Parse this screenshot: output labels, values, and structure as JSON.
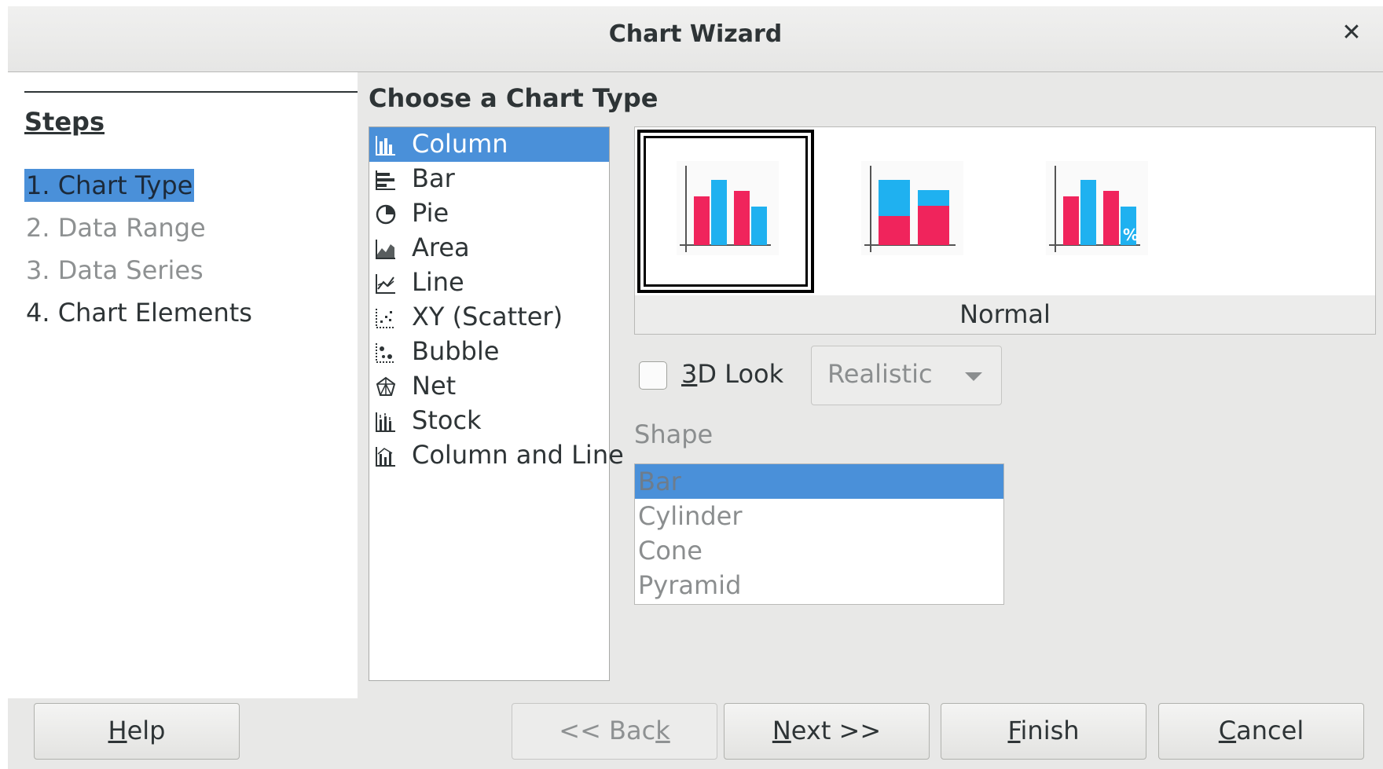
{
  "window": {
    "title": "Chart Wizard",
    "close_glyph": "✕"
  },
  "steps": {
    "heading": "Steps",
    "items": [
      {
        "label": "1. Chart Type",
        "state": "active"
      },
      {
        "label": "2. Data Range",
        "state": "disabled"
      },
      {
        "label": "3. Data Series",
        "state": "disabled"
      },
      {
        "label": "4. Chart Elements",
        "state": "normal"
      }
    ]
  },
  "main": {
    "section_title": "Choose a Chart Type",
    "chart_types": [
      {
        "label": "Column",
        "icon": "column-chart-icon",
        "selected": true
      },
      {
        "label": "Bar",
        "icon": "bar-chart-icon",
        "selected": false
      },
      {
        "label": "Pie",
        "icon": "pie-chart-icon",
        "selected": false
      },
      {
        "label": "Area",
        "icon": "area-chart-icon",
        "selected": false
      },
      {
        "label": "Line",
        "icon": "line-chart-icon",
        "selected": false
      },
      {
        "label": "XY (Scatter)",
        "icon": "scatter-chart-icon",
        "selected": false
      },
      {
        "label": "Bubble",
        "icon": "bubble-chart-icon",
        "selected": false
      },
      {
        "label": "Net",
        "icon": "net-chart-icon",
        "selected": false
      },
      {
        "label": "Stock",
        "icon": "stock-chart-icon",
        "selected": false
      },
      {
        "label": "Column and Line",
        "icon": "column-and-line-chart-icon",
        "selected": false
      }
    ],
    "variants": {
      "caption": "Normal",
      "items": [
        {
          "name": "normal",
          "selected": true
        },
        {
          "name": "stacked",
          "selected": false
        },
        {
          "name": "percent-stacked",
          "selected": false,
          "badge": "%"
        }
      ]
    },
    "look_3d": {
      "mnemonic": "3",
      "label_rest": "D Look",
      "checked": false
    },
    "look_3d_style": {
      "value": "Realistic"
    },
    "shape": {
      "label": "Shape",
      "items": [
        {
          "label": "Bar",
          "selected": true
        },
        {
          "label": "Cylinder",
          "selected": false
        },
        {
          "label": "Cone",
          "selected": false
        },
        {
          "label": "Pyramid",
          "selected": false
        }
      ]
    }
  },
  "buttons": {
    "help": {
      "mnemonic": "H",
      "rest": "elp"
    },
    "back": {
      "pre": "<< Bac",
      "mnemonic": "k",
      "rest": ""
    },
    "next": {
      "mnemonic": "N",
      "rest": "ext >>"
    },
    "finish": {
      "mnemonic": "F",
      "rest": "inish"
    },
    "cancel": {
      "mnemonic": "C",
      "rest": "ancel"
    }
  },
  "colors": {
    "accent": "#4a90d9",
    "series_a": "#f0245c",
    "series_b": "#1fb1f0"
  }
}
